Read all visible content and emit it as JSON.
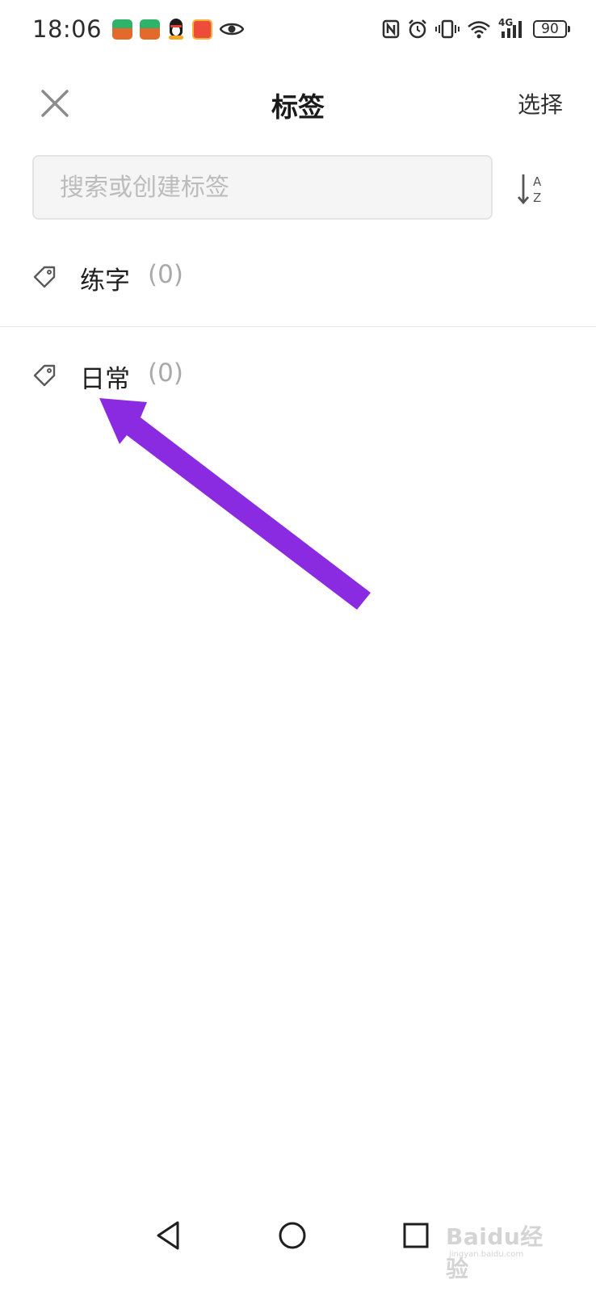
{
  "status_bar": {
    "time": "18:06",
    "battery_level": "90",
    "network_label": "4G",
    "icons": [
      "app-badge-icon",
      "app-badge-icon",
      "qq-penguin-icon",
      "app-badge-icon",
      "eye-icon",
      "nfc-icon",
      "alarm-icon",
      "vibrate-icon",
      "wifi-icon",
      "signal-icon",
      "battery-icon"
    ]
  },
  "header": {
    "title": "标签",
    "select_label": "选择",
    "close_icon": "close-icon"
  },
  "search": {
    "placeholder": "搜索或创建标签",
    "value": "",
    "sort_icon": "sort-az-icon"
  },
  "tags": [
    {
      "name": "练字",
      "count": "(0)",
      "icon": "tag-icon"
    },
    {
      "name": "日常",
      "count": "(0)",
      "icon": "tag-icon"
    }
  ],
  "annotation": {
    "arrow_color": "#8a2be2"
  },
  "nav_bar": {
    "icons": [
      "back-icon",
      "home-icon",
      "recent-apps-icon"
    ]
  },
  "watermark": {
    "text": "Baidu经验",
    "url": "jingyan.baidu.com"
  }
}
